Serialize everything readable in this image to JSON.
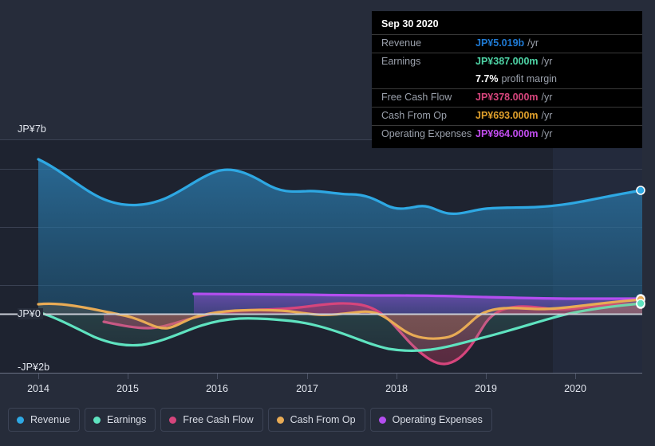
{
  "tooltip": {
    "date": "Sep 30 2020",
    "rows": [
      {
        "key": "Revenue",
        "value": "JP¥5.019b",
        "unit": "/yr",
        "color": "#1f7ad4"
      },
      {
        "key": "Earnings",
        "value": "JP¥387.000m",
        "unit": "/yr",
        "color": "#4ed3a5"
      },
      {
        "key": "Free Cash Flow",
        "value": "JP¥378.000m",
        "unit": "/yr",
        "color": "#d6457c"
      },
      {
        "key": "Cash From Op",
        "value": "JP¥693.000m",
        "unit": "/yr",
        "color": "#e0a02c"
      },
      {
        "key": "Operating Expenses",
        "value": "JP¥964.000m",
        "unit": "/yr",
        "color": "#c24df0"
      }
    ],
    "margin_value": "7.7%",
    "margin_text": "profit margin"
  },
  "legend": {
    "items": [
      {
        "label": "Revenue",
        "color": "#2ea8e3"
      },
      {
        "label": "Earnings",
        "color": "#5fe3c0"
      },
      {
        "label": "Free Cash Flow",
        "color": "#d6457c"
      },
      {
        "label": "Cash From Op",
        "color": "#e8ab55"
      },
      {
        "label": "Operating Expenses",
        "color": "#b44ef0"
      }
    ]
  },
  "axis": {
    "y_top": "JP¥7b",
    "y_zero": "JP¥0",
    "y_bottom": "-JP¥2b",
    "x_ticks": [
      "2014",
      "2015",
      "2016",
      "2017",
      "2018",
      "2019",
      "2020"
    ]
  },
  "chart_data": {
    "type": "area",
    "title": "",
    "xlabel": "",
    "ylabel": "JP¥",
    "ylim": [
      -2000000000,
      7000000000
    ],
    "y_ticks": [
      7000000000,
      0,
      -2000000000
    ],
    "grid": true,
    "legend_position": "bottom",
    "x": [
      "2014",
      "2015",
      "2016",
      "2017",
      "2018",
      "2019",
      "2020",
      "Sep 30 2020"
    ],
    "series": [
      {
        "name": "Revenue",
        "color": "#2ea8e3",
        "unit": "JP¥",
        "values": [
          6300000000,
          4800000000,
          5500000000,
          4900000000,
          4500000000,
          4400000000,
          4600000000,
          5019000000
        ]
      },
      {
        "name": "Earnings",
        "color": "#5fe3c0",
        "unit": "JP¥",
        "values": [
          -50000000,
          -1050000000,
          -820000000,
          -1000000000,
          -1250000000,
          -900000000,
          -300000000,
          387000000
        ]
      },
      {
        "name": "Free Cash Flow",
        "color": "#d6457c",
        "unit": "JP¥",
        "values": [
          null,
          -300000000,
          60000000,
          120000000,
          -1900000000,
          80000000,
          220000000,
          378000000
        ]
      },
      {
        "name": "Cash From Op",
        "color": "#e8ab55",
        "unit": "JP¥",
        "values": [
          420000000,
          -90000000,
          80000000,
          160000000,
          -480000000,
          180000000,
          330000000,
          693000000
        ]
      },
      {
        "name": "Operating Expenses",
        "color": "#b44ef0",
        "unit": "JP¥",
        "values": [
          null,
          null,
          1030000000,
          1010000000,
          1000000000,
          980000000,
          950000000,
          964000000
        ]
      }
    ],
    "forecast_region_start": "2020"
  }
}
